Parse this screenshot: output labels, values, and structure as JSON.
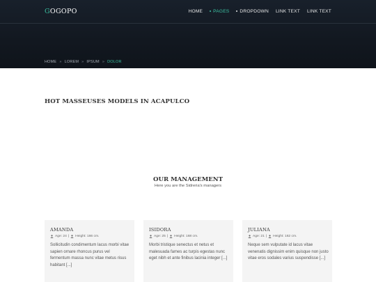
{
  "header": {
    "logo_first": "G",
    "logo_rest": "OGOPO",
    "nav": [
      {
        "label": "HOME"
      },
      {
        "label": "PAGES"
      },
      {
        "label": "DROPDOWN"
      },
      {
        "label": "LINK TEXT"
      },
      {
        "label": "LINK TEXT"
      }
    ]
  },
  "breadcrumb": {
    "items": [
      "HOME",
      "LOREM",
      "IPSUM"
    ],
    "separator": "»",
    "current": "DOLOR"
  },
  "page": {
    "title": "HOT MASSEUSES MODELS IN ACAPULCO"
  },
  "management": {
    "heading": "OUR MANAGEMENT",
    "subheading": "Here you are the Sidreria's managers",
    "members": [
      {
        "name": "AMANDA",
        "age": "Age: 24",
        "height": "Height: 166 cm.",
        "bio": "Sollicitudin condimentum lacus morbi vitae sapien ornare rhoncus purus vel fermentum massa nunc vitae metus risus habitant [...]"
      },
      {
        "name": "ISIDORA",
        "age": "Age: 25",
        "height": "Height: 168 cm.",
        "bio": "Morbi tristique senectus et netus et malesuada fames ac turpis egestas nunc eget nibh et ante finibus lacinia integer [...]"
      },
      {
        "name": "JULIANA",
        "age": "Age: 21",
        "height": "Height: 162 cm.",
        "bio": "Neque sem vulputate id lacus vitae venenatis dignissim enim quisque non justo vitae eros sodales varius suspendisse [...]"
      }
    ]
  },
  "colors": {
    "accent": "#3cc1a2",
    "hero_bg": "#141b24",
    "card_bg": "#f4f4f4"
  },
  "icons": {
    "meta": "person-icon"
  }
}
